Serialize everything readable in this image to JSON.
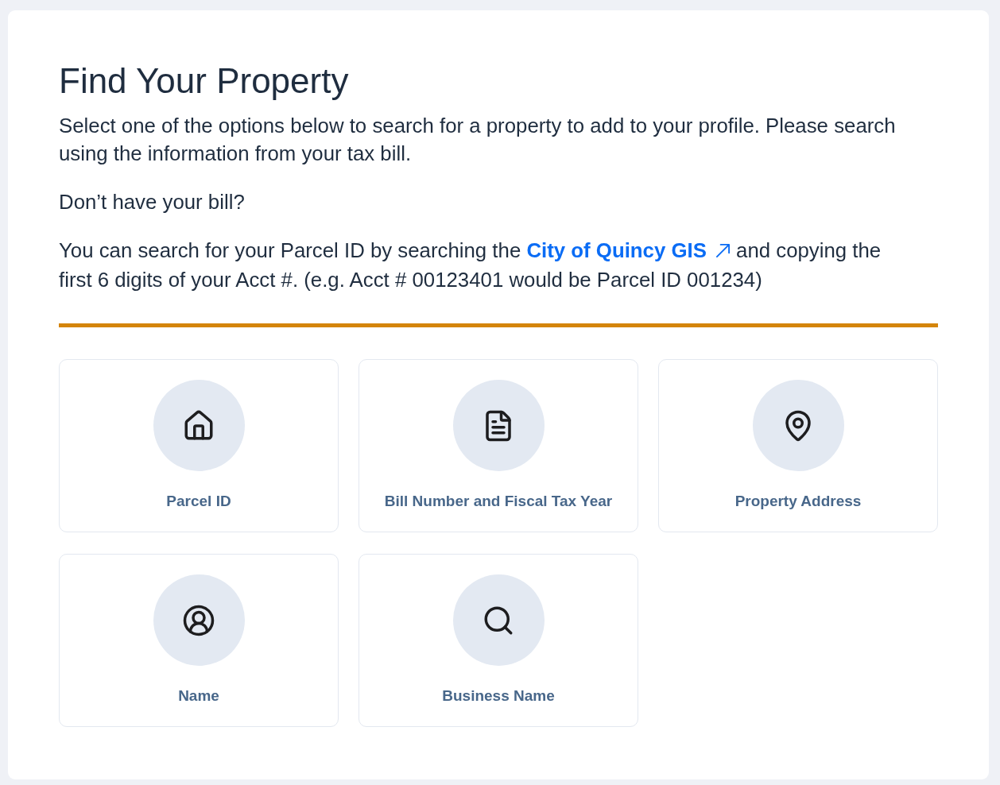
{
  "title": "Find Your Property",
  "intro": "Select one of the options below to search for a property to add to your profile. Please search using the information from your tax bill.",
  "question": "Don’t have your bill?",
  "gis_note": {
    "before": "You can search for your Parcel ID by searching the",
    "link": {
      "label": "City of Quincy GIS"
    },
    "after": "and copying the first 6 digits of your Acct #. (e.g. Acct # 00123401 would be Parcel ID 001234)"
  },
  "options": [
    {
      "label": "Parcel ID"
    },
    {
      "label": "Bill Number and Fiscal Tax Year"
    },
    {
      "label": "Property Address"
    },
    {
      "label": "Name"
    },
    {
      "label": "Business Name"
    }
  ]
}
